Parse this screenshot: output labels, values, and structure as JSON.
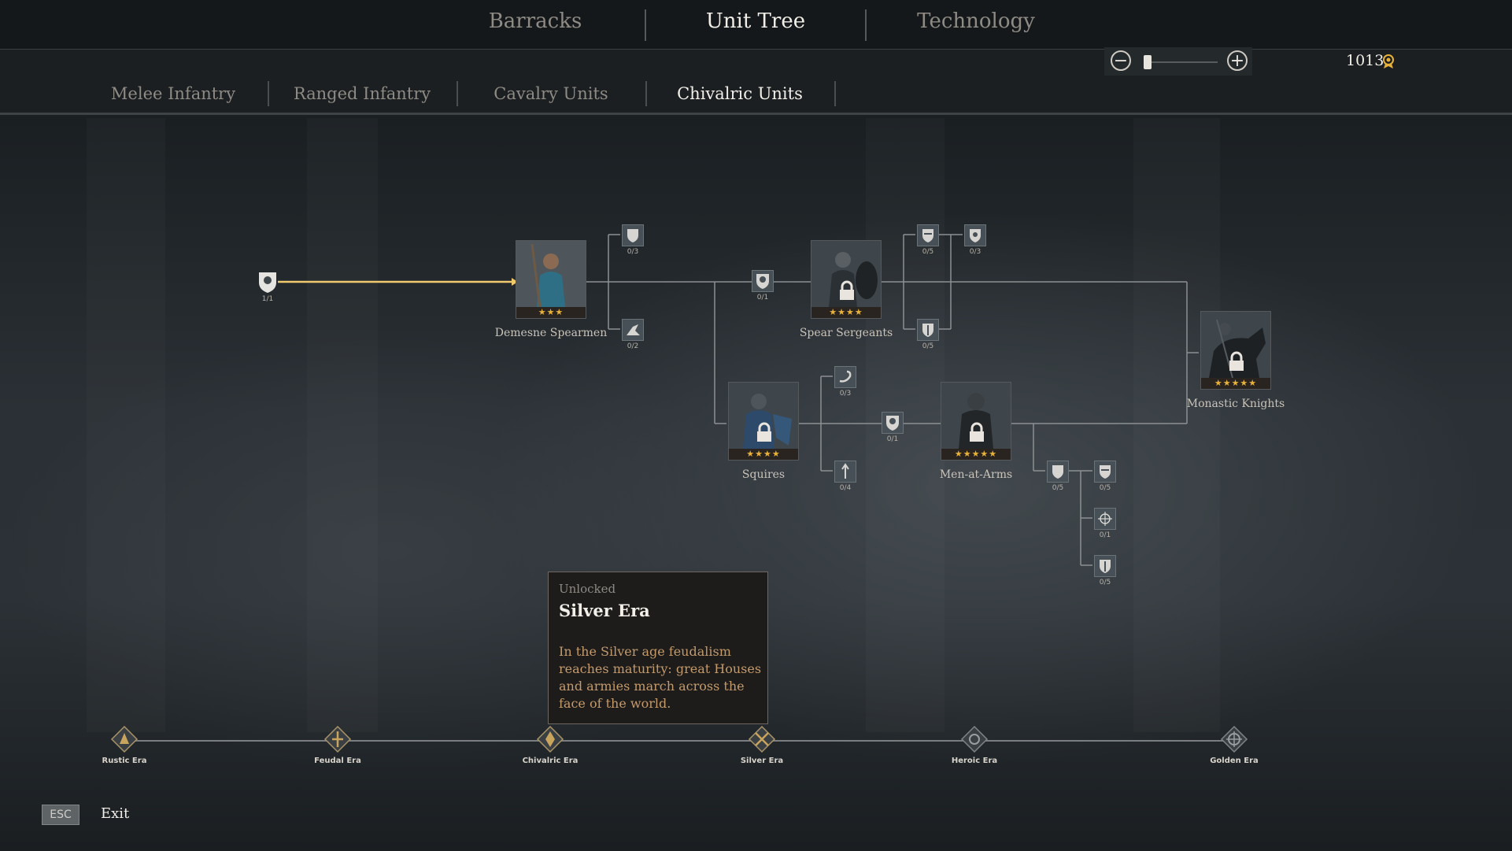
{
  "top_tabs": [
    {
      "label": "Barracks",
      "active": false
    },
    {
      "label": "Unit Tree",
      "active": true
    },
    {
      "label": "Technology",
      "active": false
    }
  ],
  "sub_tabs": [
    {
      "label": "Melee Infantry",
      "active": false
    },
    {
      "label": "Ranged Infantry",
      "active": false
    },
    {
      "label": "Cavalry Units",
      "active": false
    },
    {
      "label": "Chivalric Units",
      "active": true
    }
  ],
  "zoom": {
    "minus_icon": "minus-icon",
    "plus_icon": "plus-icon",
    "level": 0.0
  },
  "currency": {
    "amount": "1013",
    "icon": "renown-icon",
    "color": "#e8b13a"
  },
  "units": [
    {
      "name": "Demesne Spearmen",
      "tier": 3,
      "locked": false
    },
    {
      "name": "Spear Sergeants",
      "tier": 4,
      "locked": true
    },
    {
      "name": "Squires",
      "tier": 4,
      "locked": true
    },
    {
      "name": "Men-at-Arms",
      "tier": 5,
      "locked": true
    },
    {
      "name": "Monastic Knights",
      "tier": 5,
      "locked": true
    }
  ],
  "nodes": [
    {
      "id": "root",
      "count": "1/1",
      "icon": "crest-icon"
    },
    {
      "id": "ds-up-1",
      "count": "0/3",
      "icon": "shield-icon"
    },
    {
      "id": "ds-up-2",
      "count": "0/2",
      "icon": "kneel-icon"
    },
    {
      "id": "ss-unlock",
      "count": "0/1",
      "icon": "crest-icon"
    },
    {
      "id": "ss-up-1",
      "count": "0/5",
      "icon": "shield-icon"
    },
    {
      "id": "ss-up-2",
      "count": "0/3",
      "icon": "shield-icon"
    },
    {
      "id": "ss-up-3",
      "count": "0/5",
      "icon": "shield-icon"
    },
    {
      "id": "sq-up-1",
      "count": "0/3",
      "icon": "slash-icon"
    },
    {
      "id": "sq-up-2",
      "count": "0/4",
      "icon": "spear-icon"
    },
    {
      "id": "maa-unlock",
      "count": "0/1",
      "icon": "crest-icon"
    },
    {
      "id": "maa-up-1",
      "count": "0/5",
      "icon": "shield-icon"
    },
    {
      "id": "maa-up-2",
      "count": "0/5",
      "icon": "shield-icon"
    },
    {
      "id": "maa-up-3",
      "count": "0/1",
      "icon": "target-icon"
    },
    {
      "id": "maa-up-4",
      "count": "0/5",
      "icon": "shield-icon"
    }
  ],
  "tooltip": {
    "status": "Unlocked",
    "title": "Silver Era",
    "body": "In the Silver age feudalism reaches maturity: great Houses and armies march across the face of the world."
  },
  "eras": [
    {
      "label": "Rustic Era",
      "icon": "rustic-era-icon"
    },
    {
      "label": "Feudal Era",
      "icon": "feudal-era-icon"
    },
    {
      "label": "Chivalric Era",
      "icon": "chivalric-era-icon"
    },
    {
      "label": "Silver Era",
      "icon": "silver-era-icon"
    },
    {
      "label": "Heroic Era",
      "icon": "heroic-era-icon"
    },
    {
      "label": "Golden Era",
      "icon": "golden-era-icon"
    }
  ],
  "footer": {
    "esc_label": "ESC",
    "exit_label": "Exit"
  }
}
